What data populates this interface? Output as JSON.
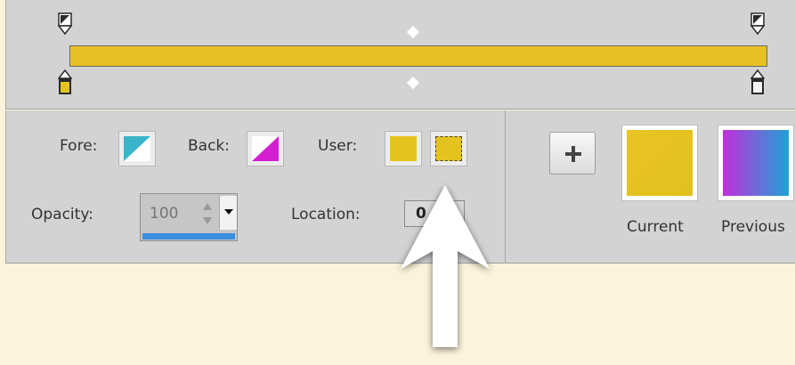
{
  "gradient_editor": {
    "bar_color": "#e7c123",
    "opacity_stops": [
      {
        "name": "opacity-stop-left",
        "color": "#2a2a2a"
      },
      {
        "name": "opacity-stop-right",
        "color": "#2a2a2a"
      }
    ],
    "color_stops": [
      {
        "name": "color-stop-left",
        "color": "#e4c31e"
      },
      {
        "name": "color-stop-right",
        "color": "#f3f3f3"
      }
    ],
    "midpoint_color": "#ffffff"
  },
  "stop_settings": {
    "fore_label": "Fore:",
    "back_label": "Back:",
    "user_label": "User:",
    "fore_colors": [
      "#3ab4c8",
      "#ffffff"
    ],
    "back_colors": [
      "#d51ed2",
      "#ffffff"
    ],
    "user_color": "#e4c31e",
    "opacity_label": "Opacity:",
    "opacity_value": "100",
    "opacity_slider_color": "#3b8fde",
    "location_label": "Location:",
    "location_value": "0"
  },
  "presets": {
    "add_button_icon": "plus-icon",
    "add_button_glyph": "+",
    "items": [
      {
        "label": "Current",
        "colors": [
          "#e8c324",
          "#e2c11e"
        ]
      },
      {
        "label": "Previous",
        "colors": [
          "#c12edd",
          "#1fa3d6"
        ]
      }
    ]
  },
  "annotation": {
    "arrow_icon": "callout-arrow-icon",
    "arrow_color": "#ffffff"
  }
}
